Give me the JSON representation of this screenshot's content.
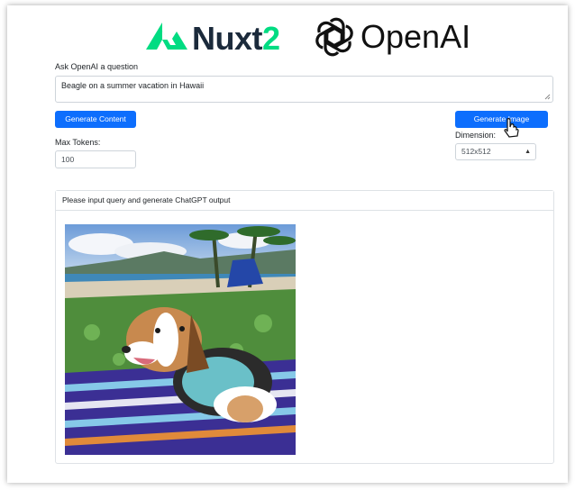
{
  "brand": {
    "nuxt_name": "Nuxt",
    "nuxt_version": "2",
    "openai_name": "OpenAI",
    "nuxt_color": "#00dc82",
    "nuxt_dark": "#1b2a3b"
  },
  "form": {
    "question_label": "Ask OpenAI a question",
    "question_value": "Beagle on a summer vacation in Hawaii",
    "generate_content_label": "Generate Content",
    "generate_image_label": "Generate Image",
    "max_tokens_label": "Max Tokens:",
    "max_tokens_value": "100",
    "dimension_label": "Dimension:",
    "dimension_value": "512x512",
    "accent_color": "#0d6efd"
  },
  "output": {
    "header_text": "Please input query and generate ChatGPT output"
  }
}
